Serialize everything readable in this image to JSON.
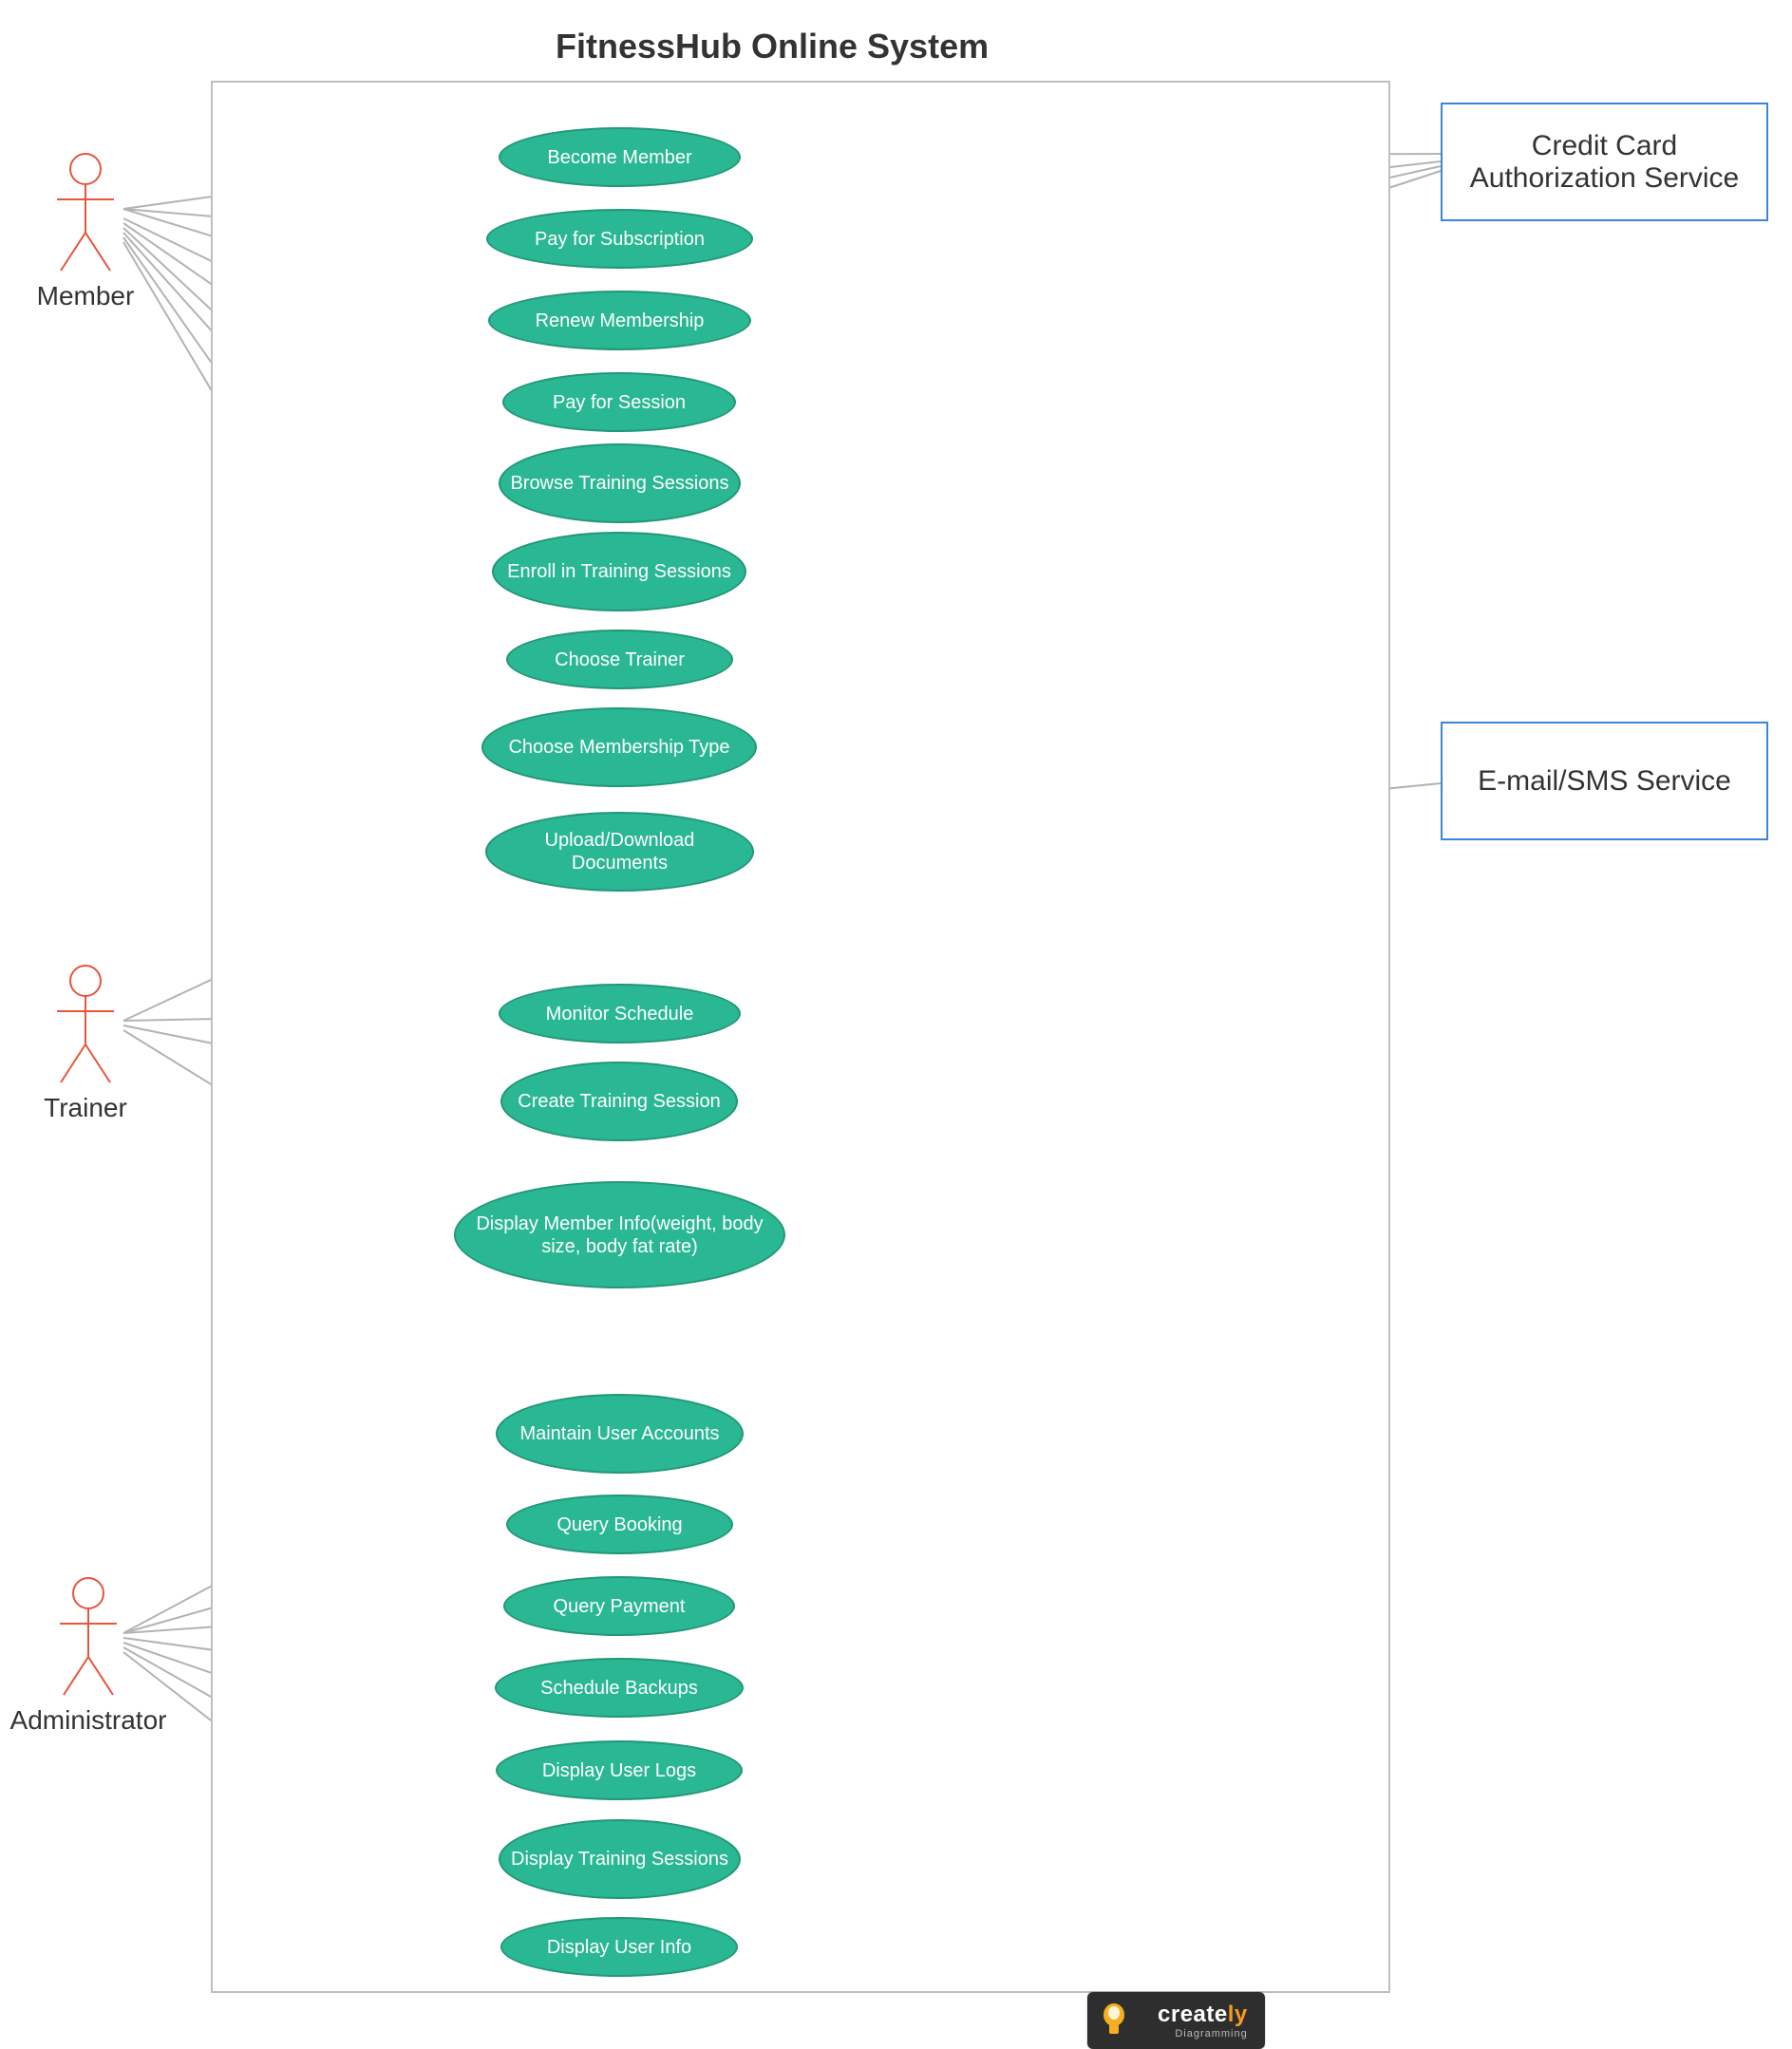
{
  "title": "FitnessHub Online System",
  "actors": {
    "member": "Member",
    "trainer": "Trainer",
    "administrator": "Administrator"
  },
  "usecases": {
    "become_member": "Become Member",
    "pay_subscription": "Pay for Subscription",
    "renew_membership": "Renew Membership",
    "pay_session": "Pay for Session",
    "browse_sessions": "Browse Training Sessions",
    "enroll_sessions": "Enroll in Training Sessions",
    "choose_trainer": "Choose Trainer",
    "choose_membership_type": "Choose Membership Type",
    "upload_download_docs": "Upload/Download Documents",
    "monitor_schedule": "Monitor Schedule",
    "create_training_session": "Create Training Session",
    "display_member_info": "Display Member Info(weight, body size, body fat rate)",
    "maintain_user_accounts": "Maintain User Accounts",
    "query_booking": "Query Booking",
    "query_payment": "Query Payment",
    "schedule_backups": "Schedule Backups",
    "display_user_logs": "Display User Logs",
    "display_training_sessions": "Display Training Sessions",
    "display_user_info": "Display User Info"
  },
  "services": {
    "credit_card": "Credit Card Authorization Service",
    "email_sms": "E-mail/SMS Service"
  },
  "logo": {
    "brand_main": "create",
    "brand_suffix": "ly",
    "tagline": "Diagramming"
  },
  "chart_data": {
    "type": "uml-use-case",
    "system": "FitnessHub Online System",
    "actors": [
      "Member",
      "Trainer",
      "Administrator"
    ],
    "external_services": [
      "Credit Card Authorization Service",
      "E-mail/SMS Service"
    ],
    "usecases": [
      "Become Member",
      "Pay for Subscription",
      "Renew Membership",
      "Pay for Session",
      "Browse Training Sessions",
      "Enroll in Training Sessions",
      "Choose Trainer",
      "Choose Membership Type",
      "Upload/Download Documents",
      "Monitor Schedule",
      "Create Training Session",
      "Display Member Info(weight, body size, body fat rate)",
      "Maintain User Accounts",
      "Query Booking",
      "Query Payment",
      "Schedule Backups",
      "Display User Logs",
      "Display Training Sessions",
      "Display User Info"
    ],
    "associations": [
      {
        "actor": "Member",
        "usecase": "Become Member"
      },
      {
        "actor": "Member",
        "usecase": "Pay for Subscription"
      },
      {
        "actor": "Member",
        "usecase": "Renew Membership"
      },
      {
        "actor": "Member",
        "usecase": "Pay for Session"
      },
      {
        "actor": "Member",
        "usecase": "Browse Training Sessions"
      },
      {
        "actor": "Member",
        "usecase": "Enroll in Training Sessions"
      },
      {
        "actor": "Member",
        "usecase": "Choose Trainer"
      },
      {
        "actor": "Member",
        "usecase": "Choose Membership Type"
      },
      {
        "actor": "Member",
        "usecase": "Upload/Download Documents"
      },
      {
        "actor": "Trainer",
        "usecase": "Upload/Download Documents"
      },
      {
        "actor": "Trainer",
        "usecase": "Monitor Schedule"
      },
      {
        "actor": "Trainer",
        "usecase": "Create Training Session"
      },
      {
        "actor": "Trainer",
        "usecase": "Display Member Info(weight, body size, body fat rate)"
      },
      {
        "actor": "Administrator",
        "usecase": "Maintain User Accounts"
      },
      {
        "actor": "Administrator",
        "usecase": "Query Booking"
      },
      {
        "actor": "Administrator",
        "usecase": "Query Payment"
      },
      {
        "actor": "Administrator",
        "usecase": "Schedule Backups"
      },
      {
        "actor": "Administrator",
        "usecase": "Display User Logs"
      },
      {
        "actor": "Administrator",
        "usecase": "Display Training Sessions"
      },
      {
        "actor": "Administrator",
        "usecase": "Display User Info"
      },
      {
        "service": "Credit Card Authorization Service",
        "usecase": "Become Member"
      },
      {
        "service": "Credit Card Authorization Service",
        "usecase": "Pay for Subscription"
      },
      {
        "service": "Credit Card Authorization Service",
        "usecase": "Renew Membership"
      },
      {
        "service": "Credit Card Authorization Service",
        "usecase": "Pay for Session"
      },
      {
        "service": "E-mail/SMS Service",
        "usecase": "Upload/Download Documents"
      }
    ]
  }
}
